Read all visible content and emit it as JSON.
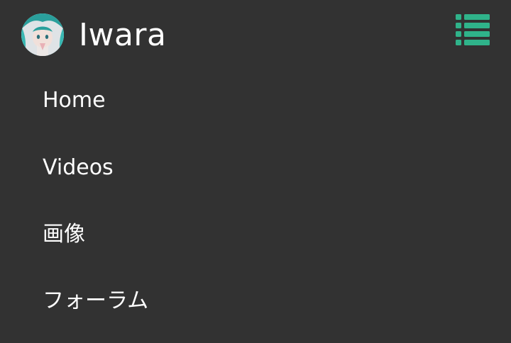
{
  "header": {
    "title": "Iwara",
    "avatar_icon": "avatar-image",
    "menu_icon": "list-menu-icon",
    "accent_color": "#2fb38a"
  },
  "nav": {
    "items": [
      {
        "label": "Home"
      },
      {
        "label": "Videos"
      },
      {
        "label": "画像"
      },
      {
        "label": "フォーラム"
      }
    ]
  },
  "colors": {
    "background": "#323232",
    "text": "#ffffff"
  }
}
